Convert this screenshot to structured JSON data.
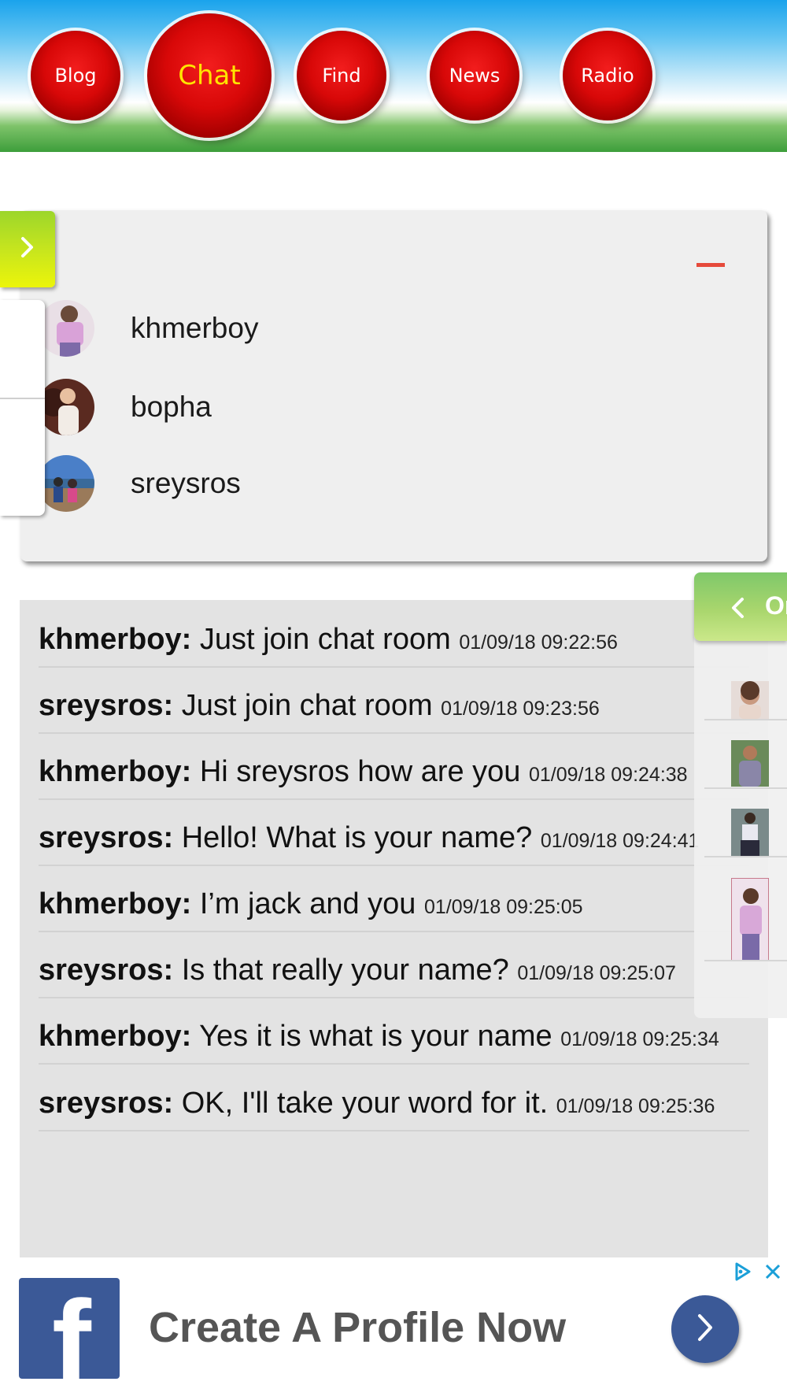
{
  "nav": {
    "blog": "Blog",
    "chat": "Chat",
    "find": "Find",
    "news": "News",
    "radio": "Radio"
  },
  "room_users": [
    {
      "name": "khmerboy",
      "avatar": "user-photo-icon"
    },
    {
      "name": "bopha",
      "avatar": "user-photo-icon"
    },
    {
      "name": "sreysros",
      "avatar": "user-photo-icon"
    }
  ],
  "messages": [
    {
      "user": "khmerboy:",
      "text": "Just join chat room",
      "time": "01/09/18 09:22:56"
    },
    {
      "user": "sreysros:",
      "text": "Just join chat room",
      "time": "01/09/18 09:23:56"
    },
    {
      "user": "khmerboy:",
      "text": "Hi sreysros how are you",
      "time": "01/09/18 09:24:38"
    },
    {
      "user": "sreysros:",
      "text": "Hello! What is your name?",
      "time": "01/09/18 09:24:41"
    },
    {
      "user": "khmerboy:",
      "text": "I’m jack and you",
      "time": "01/09/18 09:25:05"
    },
    {
      "user": "sreysros:",
      "text": "Is that really your name?",
      "time": "01/09/18 09:25:07"
    },
    {
      "user": "khmerboy:",
      "text": "Yes it is what is your name",
      "time": "01/09/18 09:25:34"
    },
    {
      "user": "sreysros:",
      "text": "OK, I'll take your word for it.",
      "time": "01/09/18 09:25:36"
    }
  ],
  "online_drawer": {
    "tab_label": "Or"
  },
  "ad": {
    "text": "Create A Profile Now",
    "brand_color": "#3b5997"
  },
  "colors": {
    "nav_button": "#d80808",
    "active_nav_text": "#ffe500",
    "minimize": "#e64a3b"
  },
  "icons": {
    "left_tab": "chevron-right-icon",
    "right_tab": "chevron-left-icon",
    "ad_go": "chevron-right-icon",
    "ad_choices": "adchoices-icon",
    "ad_close": "close-icon",
    "fb_logo": "facebook-logo"
  }
}
